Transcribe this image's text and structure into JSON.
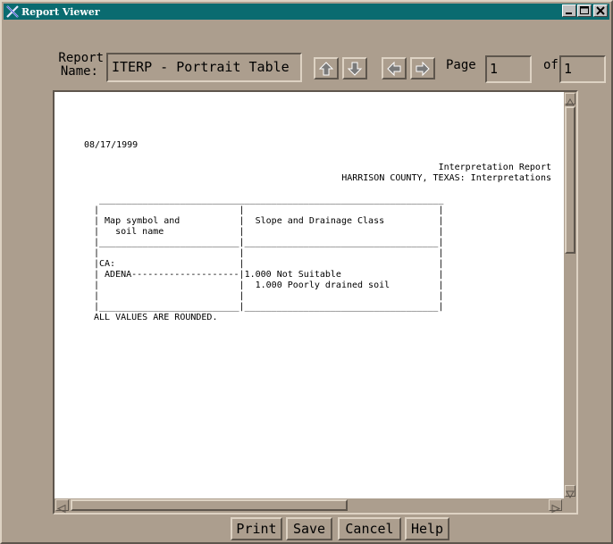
{
  "window": {
    "title": "Report Viewer",
    "app_icon": "x-logo-icon",
    "controls": [
      "minimize-icon",
      "maximize-icon",
      "close-icon"
    ]
  },
  "toolbar": {
    "report_name_label_line1": "Report",
    "report_name_label_line2": "Name:",
    "report_name_value": "ITERP - Portrait Table",
    "nav_buttons": [
      "arrow-up-icon",
      "arrow-down-icon",
      "arrow-left-icon",
      "arrow-right-icon"
    ],
    "page_label": "Page",
    "page_value": "1",
    "of_label": "of",
    "total_pages": "1"
  },
  "report": {
    "date": "08/17/1999",
    "title": "Interpretation Report",
    "subtitle": "HARRISON COUNTY, TEXAS: Interpretations",
    "lines": [
      " ________________________________________________________________",
      "|                          |                                    |",
      "| Map symbol and           |  Slope and Drainage Class          |",
      "|   soil name              |                                    |",
      "|__________________________|____________________________________|",
      "|                          |                                    |",
      "|CA:                       |                                    |",
      "| ADENA--------------------|1.000 Not Suitable                  |",
      "|                          |  1.000 Poorly drained soil         |",
      "|                          |                                    |",
      "|__________________________|____________________________________|",
      "ALL VALUES ARE ROUNDED."
    ]
  },
  "buttons": {
    "print": "Print",
    "save": "Save",
    "cancel": "Cancel",
    "help": "Help"
  },
  "colors": {
    "window_bg": "#ac9e8e",
    "titlebar": "#0a6b70",
    "viewport_bg": "#ffffff"
  }
}
